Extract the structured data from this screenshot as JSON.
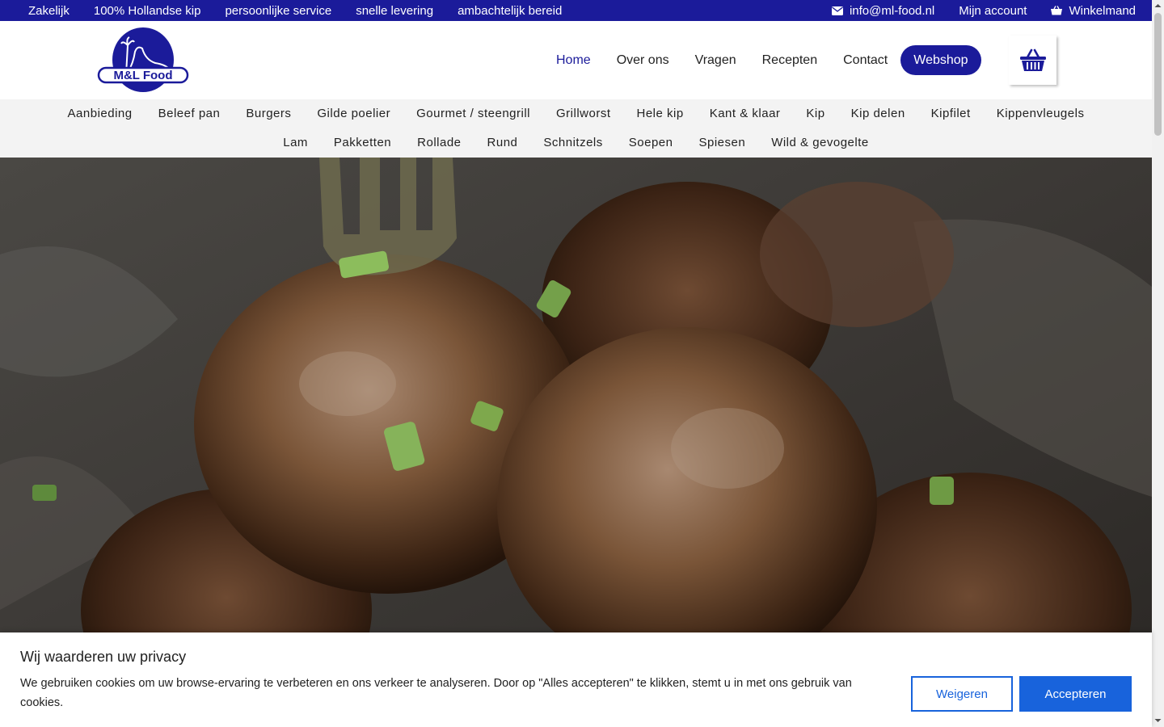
{
  "topbar": {
    "items": [
      "Zakelijk",
      "100% Hollandse kip",
      "persoonlijke service",
      "snelle levering",
      "ambachtelijk bereid"
    ],
    "email": "info@ml-food.nl",
    "account": "Mijn account",
    "cart": "Winkelmand"
  },
  "logo": {
    "text": "M&L Food"
  },
  "mainnav": {
    "items": [
      "Home",
      "Over ons",
      "Vragen",
      "Recepten",
      "Contact"
    ],
    "webshop": "Webshop"
  },
  "categories": {
    "row1": [
      "Aanbieding",
      "Beleef pan",
      "Burgers",
      "Gilde poelier",
      "Gourmet / steengrill",
      "Grillworst",
      "Hele kip",
      "Kant & klaar",
      "Kip",
      "Kip delen",
      "Kipfilet",
      "Kippenvleugels"
    ],
    "row2": [
      "Lam",
      "Pakketten",
      "Rollade",
      "Rund",
      "Schnitzels",
      "Soepen",
      "Spiesen",
      "Wild & gevogelte"
    ]
  },
  "cookie": {
    "title": "Wij waarderen uw privacy",
    "text": "We gebruiken cookies om uw browse-ervaring te verbeteren en ons verkeer te analyseren. Door op \"Alles accepteren\" te klikken, stemt u in met ons gebruik van cookies.",
    "deny": "Weigeren",
    "accept": "Accepteren"
  },
  "colors": {
    "brand": "#1b1b9a",
    "cookie_button": "#1863dc"
  }
}
